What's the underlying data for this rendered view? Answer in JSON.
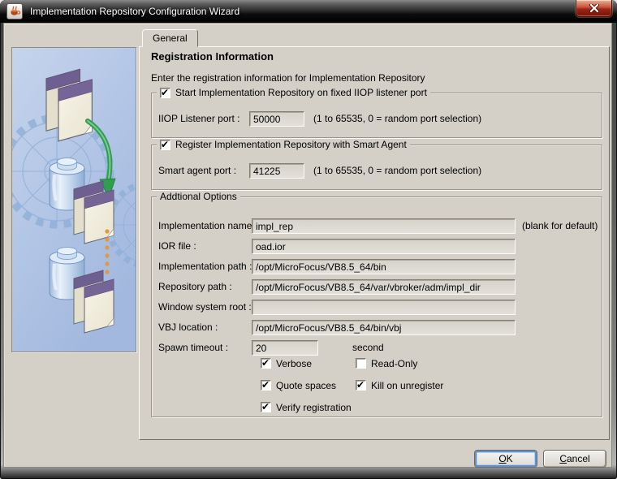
{
  "window": {
    "title": "Implementation Repository Configuration Wizard"
  },
  "tab": {
    "label": "General"
  },
  "header": {
    "title": "Registration Information",
    "subtitle": "Enter the registration information for Implementation Repository"
  },
  "groups": {
    "iiop": {
      "title": "Start Implementation Repository on fixed IIOP listener port",
      "checked": true,
      "field_label": "IIOP Listener port :",
      "value": "50000",
      "note": "(1 to 65535, 0 = random port selection)"
    },
    "smart": {
      "title": "Register Implementation Repository with Smart Agent",
      "checked": true,
      "field_label": "Smart agent port :",
      "value": "41225",
      "note": "(1 to 65535, 0 = random port selection)"
    },
    "additional": {
      "title": "Addtional Options",
      "fields": [
        {
          "label": "Implementation name :",
          "value": "impl_rep",
          "note": "(blank for default)"
        },
        {
          "label": "IOR file :",
          "value": "oad.ior"
        },
        {
          "label": "Implementation path :",
          "value": "/opt/MicroFocus/VB8.5_64/bin"
        },
        {
          "label": "Repository path :",
          "value": "/opt/MicroFocus/VB8.5_64/var/vbroker/adm/impl_dir"
        },
        {
          "label": "Window system root :",
          "value": ""
        },
        {
          "label": "VBJ location :",
          "value": "/opt/MicroFocus/VB8.5_64/bin/vbj"
        },
        {
          "label": "Spawn timeout :",
          "value": "20",
          "note": "second"
        }
      ],
      "checkboxes": [
        {
          "label": "Verbose",
          "checked": true
        },
        {
          "label": "Read-Only",
          "checked": false
        },
        {
          "label": "Quote spaces",
          "checked": true
        },
        {
          "label": "Kill on unregister",
          "checked": true
        },
        {
          "label": "Verify registration",
          "checked": true
        }
      ]
    }
  },
  "buttons": {
    "ok": {
      "mnemonic": "O",
      "rest": "K"
    },
    "cancel": {
      "mnemonic": "C",
      "rest": "ancel"
    }
  },
  "colors": {
    "titlebar_bg": "#1b1b1b",
    "close_button_red": "#9c2716",
    "dialog_bg": "#d4d0c8",
    "artwork_bg": "#b3c6e6",
    "focus_ring_blue": "#5f92d4",
    "arrow_green": "#2f9e50",
    "dots_orange": "#dd9a3f",
    "doc_band_purple": "#756596"
  }
}
